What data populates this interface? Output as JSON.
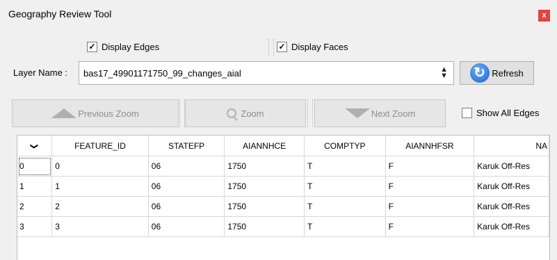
{
  "window": {
    "title": "Geography Review Tool",
    "close_label": "x"
  },
  "options": {
    "display_edges": {
      "label": "Display Edges",
      "checked": true
    },
    "display_faces": {
      "label": "Display Faces",
      "checked": true
    },
    "show_all_edges": {
      "label": "Show All Edges",
      "checked": false
    }
  },
  "layer": {
    "label": "Layer Name :",
    "value": "bas17_49901171750_99_changes_aial"
  },
  "buttons": {
    "refresh": "Refresh",
    "previous_zoom": "Previous Zoom",
    "zoom": "Zoom",
    "next_zoom": "Next Zoom"
  },
  "table": {
    "corner": "❯",
    "columns": [
      "FEATURE_ID",
      "STATEFP",
      "AIANNHCE",
      "COMPTYP",
      "AIANNHFSR",
      "NA"
    ],
    "rows": [
      {
        "header": "0",
        "cells": [
          "0",
          "06",
          "1750",
          "T",
          "F",
          "Karuk Off-Res"
        ]
      },
      {
        "header": "1",
        "cells": [
          "1",
          "06",
          "1750",
          "T",
          "F",
          "Karuk Off-Res"
        ]
      },
      {
        "header": "2",
        "cells": [
          "2",
          "06",
          "1750",
          "T",
          "F",
          "Karuk Off-Res"
        ]
      },
      {
        "header": "3",
        "cells": [
          "3",
          "06",
          "1750",
          "T",
          "F",
          "Karuk Off-Res"
        ]
      }
    ]
  }
}
